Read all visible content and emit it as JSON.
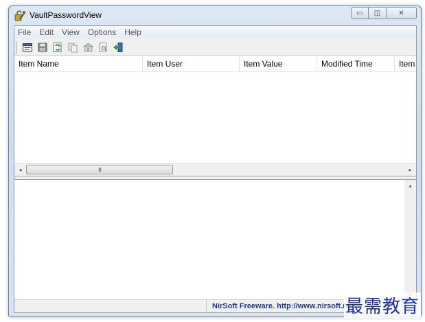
{
  "window": {
    "title": "VaultPasswordView",
    "controls": {
      "minimize": "▭",
      "maximize": "◫",
      "close": "✕"
    }
  },
  "menu": [
    "File",
    "Edit",
    "View",
    "Options",
    "Help"
  ],
  "toolbar": [
    {
      "name": "properties-icon"
    },
    {
      "name": "save-icon"
    },
    {
      "name": "refresh-icon"
    },
    {
      "name": "copy-icon"
    },
    {
      "name": "html-report-icon"
    },
    {
      "name": "find-icon"
    },
    {
      "name": "exit-icon"
    }
  ],
  "list": {
    "columns": [
      "Item Name",
      "Item User",
      "Item Value",
      "Modified Time",
      "Item"
    ]
  },
  "scrollbars": {
    "h_left": "◂",
    "h_right": "▸",
    "h_grip": "III",
    "v_up": "▴",
    "v_down": "▾"
  },
  "status": {
    "link": "NirSoft Freeware.  http://www.nirsoft.net"
  },
  "watermark": "最需教育",
  "colors": {
    "link": "#1a3aa8",
    "watermark": "#1d2fa3"
  }
}
